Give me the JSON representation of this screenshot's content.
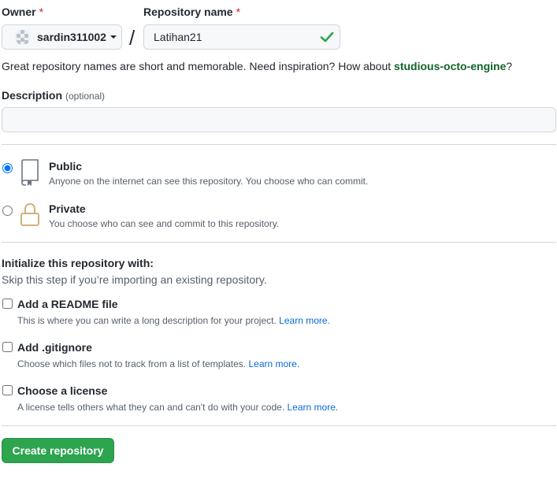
{
  "owner": {
    "label": "Owner",
    "required_mark": "*",
    "selected": "sardin311002"
  },
  "repo_name": {
    "label": "Repository name",
    "required_mark": "*",
    "value": "Latihan21",
    "separator": "/"
  },
  "hint": {
    "text": "Great repository names are short and memorable. Need inspiration? How about ",
    "suggestion": "studious-octo-engine",
    "end": "?"
  },
  "description": {
    "label": "Description",
    "optional": "(optional)",
    "value": "",
    "placeholder": ""
  },
  "visibility": {
    "public": {
      "title": "Public",
      "subtitle": "Anyone on the internet can see this repository. You choose who can commit.",
      "icon": "repo-icon",
      "selected": true
    },
    "private": {
      "title": "Private",
      "subtitle": "You choose who can see and commit to this repository.",
      "icon": "lock-icon",
      "selected": false
    }
  },
  "init": {
    "title": "Initialize this repository with:",
    "subtitle": "Skip this step if you’re importing an existing repository.",
    "readme": {
      "title": "Add a README file",
      "subtitle": "This is where you can write a long description for your project.",
      "link": "Learn more."
    },
    "gitignore": {
      "title": "Add .gitignore",
      "subtitle": "Choose which files not to track from a list of templates.",
      "link": "Learn more."
    },
    "license": {
      "title": "Choose a license",
      "subtitle": "A license tells others what they can and can't do with your code.",
      "link": "Learn more."
    }
  },
  "create_button": "Create repository",
  "colors": {
    "primary_button": "#2da44e",
    "link": "#0969da",
    "valid_check": "#2da44e",
    "suggestion": "#116329",
    "required": "#cf222e"
  }
}
